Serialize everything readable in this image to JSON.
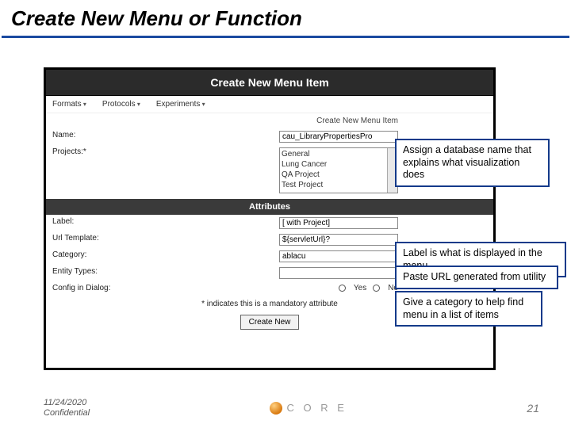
{
  "slide": {
    "title": "Create New Menu or Function"
  },
  "panel": {
    "header": "Create New Menu Item",
    "menubar": {
      "item1": "Formats",
      "item2": "Protocols",
      "item3": "Experiments"
    },
    "breadcrumb": "Create New Menu Item",
    "fields": {
      "name": {
        "label": "Name:",
        "value": "cau_LibraryPropertiesPro"
      },
      "projects": {
        "label": "Projects:*",
        "options": {
          "o1": "General",
          "o2": "Lung Cancer",
          "o3": "QA Project",
          "o4": "Test Project"
        }
      },
      "label": {
        "label": "Label:",
        "value": "[ with Project]"
      },
      "urlTemplate": {
        "label": "Url Template:",
        "value": "${servletUrl}?"
      },
      "category": {
        "label": "Category:",
        "value": "ablacu"
      },
      "entityTypes": {
        "label": "Entity Types:",
        "value": ""
      },
      "configDialog": {
        "label": "Config in Dialog:",
        "yes": "Yes",
        "no": "No"
      }
    },
    "attributesHeader": "Attributes",
    "mandatoryNote": "* indicates this is a mandatory attribute",
    "createButton": "Create New"
  },
  "callouts": {
    "c1": "Assign a database name that explains what visualization does",
    "c2": "Label is what is displayed in the menu",
    "c3": "Paste URL generated from utility",
    "c4": "Give a category to help find menu in a list of items"
  },
  "footer": {
    "date": "11/24/2020",
    "confidential": "Confidential",
    "logo": "C O R E",
    "page": "21"
  }
}
